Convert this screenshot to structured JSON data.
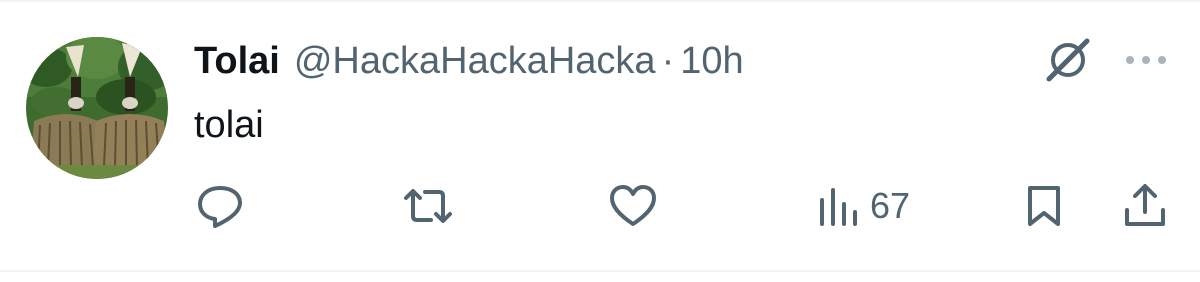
{
  "tweet": {
    "display_name": "Tolai",
    "handle": "@HackaHackaHacka",
    "separator": "·",
    "timestamp": "10h",
    "text": "tolai"
  },
  "actions": {
    "views_count": "67"
  },
  "icons": {
    "reply": "reply-icon",
    "retweet": "retweet-icon",
    "like": "heart-icon",
    "views": "views-icon",
    "bookmark": "bookmark-icon",
    "share": "share-icon",
    "grok": "grok-icon",
    "more": "more-icon"
  },
  "colors": {
    "primary_text": "#0f1419",
    "secondary_text": "#536471",
    "divider": "#eff3f4"
  }
}
